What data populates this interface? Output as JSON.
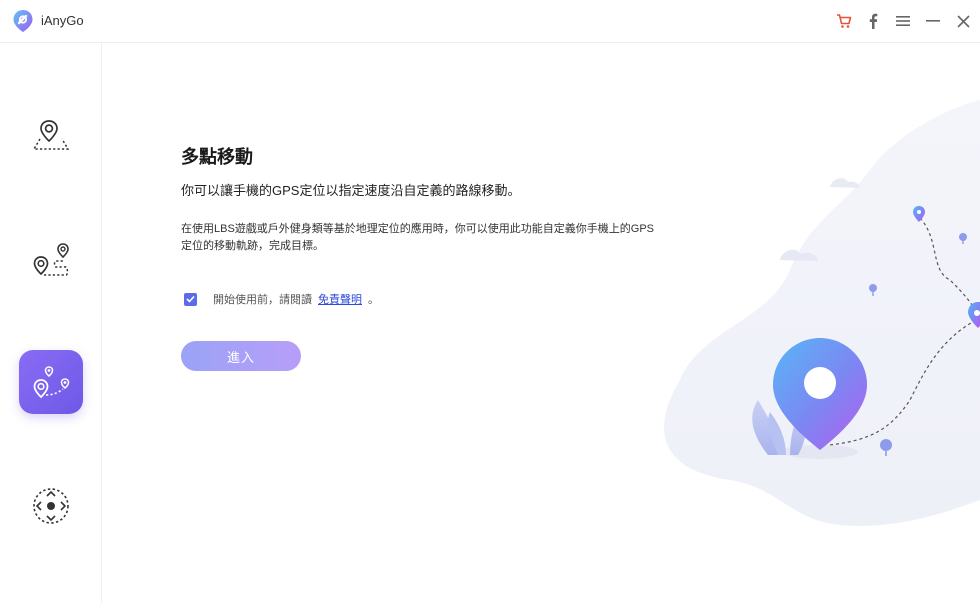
{
  "app": {
    "name": "iAnyGo"
  },
  "titlebar": {
    "icons": [
      "cart-icon",
      "facebook-icon",
      "menu-icon",
      "minimize-icon",
      "close-icon"
    ],
    "cart_color": "#e8503a",
    "icon_color": "#666666"
  },
  "sidebar": {
    "items": [
      {
        "name": "change-location",
        "icon": "single-pin-icon",
        "active": false
      },
      {
        "name": "two-spot-movement",
        "icon": "two-pin-route-icon",
        "active": false
      },
      {
        "name": "multi-spot-movement",
        "icon": "multi-pin-route-icon",
        "active": true
      },
      {
        "name": "joystick-movement",
        "icon": "joystick-icon",
        "active": false
      }
    ],
    "accent": "#7a62ee"
  },
  "main": {
    "title": "多點移動",
    "subtitle": "你可以讓手機的GPS定位以指定速度沿自定義的路線移動。",
    "description": "在使用LBS遊戲或戶外健身類等基於地理定位的應用時，你可以使用此功能自定義你手機上的GPS定位的移動軌跡，完成目標。",
    "agree_prefix": "開始使用前，請閱讀",
    "agree_link": "免責聲明",
    "agree_suffix": "。",
    "agree_checked": true,
    "enter_label": "進入"
  }
}
